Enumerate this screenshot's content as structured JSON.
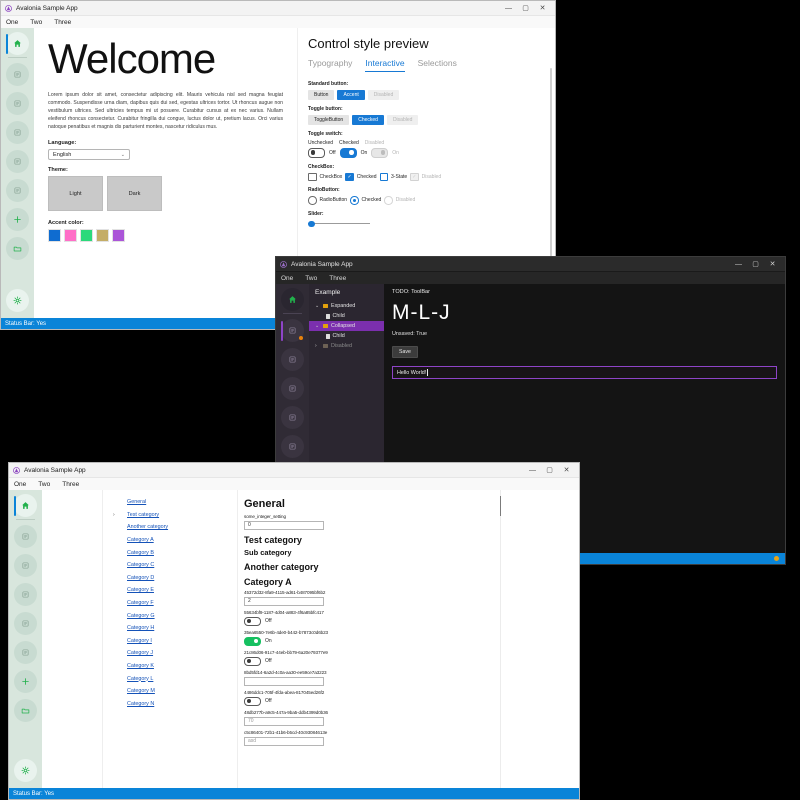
{
  "window1": {
    "title": "Avalonia Sample App",
    "titlebar_icon": "avalonia-logo-icon",
    "controls": {
      "minimize": "—",
      "maximize": "▢",
      "close": "✕"
    },
    "menu": [
      "One",
      "Two",
      "Three"
    ],
    "rail": [
      {
        "name": "home",
        "icon": "home-icon",
        "selected": true
      },
      {
        "name": "list-1",
        "icon": "list-icon",
        "selected": false
      },
      {
        "name": "list-2",
        "icon": "list-icon",
        "selected": false
      },
      {
        "name": "list-3",
        "icon": "list-icon",
        "selected": false
      },
      {
        "name": "list-4",
        "icon": "list-icon",
        "selected": false
      },
      {
        "name": "list-5",
        "icon": "list-icon",
        "selected": false
      },
      {
        "name": "add",
        "icon": "plus-icon",
        "selected": false
      },
      {
        "name": "folder",
        "icon": "folder-icon",
        "selected": false
      },
      {
        "name": "settings",
        "icon": "gear-icon",
        "selected": false
      }
    ],
    "left": {
      "heading": "Welcome",
      "paragraph": "Lorem ipsum dolor sit amet, consectetur adipiscing elit. Mauris vehicula nisl sed magna feugiat commodo. Suspendisse urna diam, dapibus quis dui sed, egestas ultrices tortor. Ut rhoncus augue non vestibulum ultrices. Sed ultricies tempus mi ut posuere. Curabitur cursus at ex nec varius. Nullam eleifend rhoncus consectetur. Curabitur fringilla dui congue, luctus dolor ut, pretium lacus. Orci varius natoque penatibus et magnis dis parturient montes, nascetur ridiculus mus.",
      "language_label": "Language:",
      "language_value": "English",
      "theme_label": "Theme:",
      "theme_buttons": [
        "Light",
        "Dark"
      ],
      "accent_label": "Accent color:",
      "accent_swatches": [
        "#0f6cd0",
        "#ff6ec7",
        "#2bd97b",
        "#c4ad66",
        "#ab55d8"
      ]
    },
    "right": {
      "title": "Control style preview",
      "tabs": [
        {
          "label": "Typography",
          "active": false
        },
        {
          "label": "Interactive",
          "active": true
        },
        {
          "label": "Selections",
          "active": false
        }
      ],
      "standard_button_label": "Standard button:",
      "standard_buttons": [
        "Button",
        "Accent",
        "Disabled"
      ],
      "toggle_button_label": "Toggle button:",
      "toggle_buttons": [
        "ToggleButton",
        "Checked",
        "Disabled"
      ],
      "toggle_switch_label": "Toggle switch:",
      "toggle_switch_names": [
        "Unchecked",
        "Checked",
        "Disabled"
      ],
      "toggle_switch_states": [
        "Off",
        "On",
        "On"
      ],
      "checkbox_label": "CheckBox:",
      "checkboxes": [
        "CheckBox",
        "Checked",
        "3-State",
        "Disabled"
      ],
      "radio_label": "RadioButton:",
      "radios": [
        "RadioButton",
        "Checked",
        "Disabled"
      ],
      "slider_label": "Slider:",
      "slider_value": 0
    },
    "statusbar": "Status Bar: Yes"
  },
  "window2": {
    "title": "Avalonia Sample App",
    "controls": {
      "minimize": "—",
      "maximize": "▢",
      "close": "✕"
    },
    "menu": [
      "One",
      "Two",
      "Three"
    ],
    "rail": [
      {
        "name": "home",
        "icon": "home-icon",
        "selected": false
      },
      {
        "name": "list-1",
        "icon": "list-icon",
        "selected": true,
        "badge": true
      },
      {
        "name": "list-2",
        "icon": "list-icon",
        "selected": false
      },
      {
        "name": "list-3",
        "icon": "list-icon",
        "selected": false
      },
      {
        "name": "list-4",
        "icon": "list-icon",
        "selected": false
      },
      {
        "name": "list-5",
        "icon": "list-icon",
        "selected": false
      },
      {
        "name": "add",
        "icon": "plus-icon",
        "selected": false
      },
      {
        "name": "folder",
        "icon": "folder-icon",
        "selected": false
      }
    ],
    "tree_header": "Example",
    "tree": [
      {
        "label": "Expanded",
        "level": 0,
        "expanded": true,
        "type": "folder",
        "selected": false,
        "disabled": false
      },
      {
        "label": "Child",
        "level": 1,
        "expanded": null,
        "type": "doc",
        "selected": false,
        "disabled": false
      },
      {
        "label": "Collapsed",
        "level": 0,
        "expanded": true,
        "type": "folder",
        "selected": true,
        "disabled": false
      },
      {
        "label": "Child",
        "level": 1,
        "expanded": null,
        "type": "doc",
        "selected": false,
        "disabled": false
      },
      {
        "label": "Disabled",
        "level": 0,
        "expanded": false,
        "type": "folder",
        "selected": false,
        "disabled": true
      }
    ],
    "toolbar_todo": "TODO: ToolBar",
    "document_title": "M-L-J",
    "unsaved": "Unsaved: True",
    "save_label": "Save",
    "editor_text": "Hello World!",
    "statusbar": ""
  },
  "window3": {
    "title": "Avalonia Sample App",
    "controls": {
      "minimize": "—",
      "maximize": "▢",
      "close": "✕"
    },
    "menu": [
      "One",
      "Two",
      "Three"
    ],
    "rail": [
      {
        "name": "home",
        "icon": "home-icon",
        "selected": true
      },
      {
        "name": "list-1",
        "icon": "list-icon",
        "selected": false
      },
      {
        "name": "list-2",
        "icon": "list-icon",
        "selected": false
      },
      {
        "name": "list-3",
        "icon": "list-icon",
        "selected": false
      },
      {
        "name": "list-4",
        "icon": "list-icon",
        "selected": false
      },
      {
        "name": "list-5",
        "icon": "list-icon",
        "selected": false
      },
      {
        "name": "add",
        "icon": "plus-icon",
        "selected": false
      },
      {
        "name": "folder",
        "icon": "folder-icon",
        "selected": false
      },
      {
        "name": "settings",
        "icon": "gear-icon",
        "selected": false
      }
    ],
    "nav": [
      {
        "label": "General",
        "expandable": false
      },
      {
        "label": "Test category",
        "expandable": true
      },
      {
        "label": "Another category",
        "expandable": false
      },
      {
        "label": "Category A",
        "expandable": false
      },
      {
        "label": "Category B",
        "expandable": false
      },
      {
        "label": "Category C",
        "expandable": false
      },
      {
        "label": "Category D",
        "expandable": false
      },
      {
        "label": "Category E",
        "expandable": false
      },
      {
        "label": "Category F",
        "expandable": false
      },
      {
        "label": "Category G",
        "expandable": false
      },
      {
        "label": "Category H",
        "expandable": false
      },
      {
        "label": "Category I",
        "expandable": false
      },
      {
        "label": "Category J",
        "expandable": false
      },
      {
        "label": "Category K",
        "expandable": false
      },
      {
        "label": "Category L",
        "expandable": false
      },
      {
        "label": "Category M",
        "expandable": false
      },
      {
        "label": "Category N",
        "expandable": false
      }
    ],
    "content": [
      {
        "kind": "h1",
        "text": "General"
      },
      {
        "kind": "key",
        "text": "some_integer_setting"
      },
      {
        "kind": "input",
        "value": "0",
        "placeholder": ""
      },
      {
        "kind": "h2",
        "text": "Test category"
      },
      {
        "kind": "h3",
        "text": "Sub category"
      },
      {
        "kind": "h2",
        "text": "Another category"
      },
      {
        "kind": "h2",
        "text": "Category A"
      },
      {
        "kind": "key",
        "text": "45372d32-8fa9-4115-ad61-b487095bf6b2"
      },
      {
        "kind": "input",
        "value": "2",
        "placeholder": ""
      },
      {
        "kind": "key",
        "text": "55634bf9-1187-4d04-a883-4f6a85bfc417"
      },
      {
        "kind": "toggle",
        "on": false,
        "state": "Off"
      },
      {
        "kind": "key",
        "text": "35ea6550-7e6b-4de0-b442-b7873c0d6b23"
      },
      {
        "kind": "toggle",
        "on": true,
        "state": "On"
      },
      {
        "kind": "key",
        "text": "21c86d06-91c7-44eb-bb79-6a20e79377e9"
      },
      {
        "kind": "toggle",
        "on": false,
        "state": "Off"
      },
      {
        "kind": "key",
        "text": "8bd5fd14-6a2d-4c0a-aa30-ee59ce7a3223"
      },
      {
        "kind": "input",
        "value": "",
        "placeholder": ""
      },
      {
        "kind": "key",
        "text": "4486ddc1-705f-4fda-abea-817045ed26f2"
      },
      {
        "kind": "toggle",
        "on": false,
        "state": "Off"
      },
      {
        "kind": "key",
        "text": "48db277b-a9c5-447a-9ba5-ddb4399d0b36"
      },
      {
        "kind": "input",
        "value": "70",
        "placeholder": ""
      },
      {
        "kind": "key",
        "text": "c5c86401-72b1-41b6-b5cd-40c93084613e"
      },
      {
        "kind": "input",
        "value": "asd",
        "placeholder": ""
      }
    ],
    "statusbar": "Status Bar: Yes"
  }
}
